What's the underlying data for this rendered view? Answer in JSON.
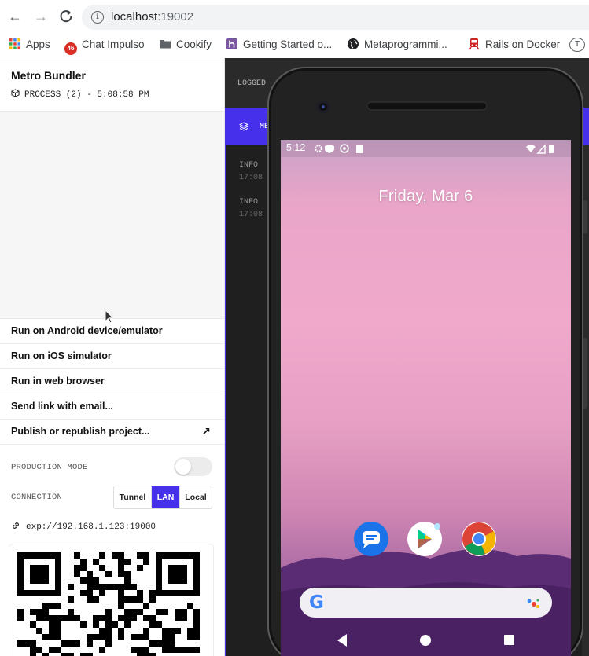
{
  "browser": {
    "url_host": "localhost",
    "url_port": ":19002",
    "bookmarks": [
      {
        "label": "Apps",
        "icon": "apps-grid-icon"
      },
      {
        "label": "Chat Impulso",
        "icon": "chat-badge-icon",
        "badge": "46"
      },
      {
        "label": "Cookify",
        "icon": "folder-icon"
      },
      {
        "label": "Getting Started o...",
        "icon": "heroku-icon"
      },
      {
        "label": "Metaprogrammi...",
        "icon": "globe-icon"
      },
      {
        "label": "Rails on Docker",
        "icon": "train-icon"
      }
    ],
    "profile_initial": "T"
  },
  "sidebar": {
    "title": "Metro Bundler",
    "process": "PROCESS (2) - 5:08:58 PM",
    "actions": [
      {
        "label": "Run on Android device/emulator"
      },
      {
        "label": "Run on iOS simulator"
      },
      {
        "label": "Run in web browser"
      },
      {
        "label": "Send link with email..."
      },
      {
        "label": "Publish or republish project...",
        "icon": "external-arrow-icon"
      }
    ],
    "production_mode_label": "PRODUCTION MODE",
    "production_mode_on": false,
    "connection_label": "CONNECTION",
    "connection_options": [
      "Tunnel",
      "LAN",
      "Local"
    ],
    "connection_selected": "LAN",
    "exp_url": "exp://192.168.1.123:19000"
  },
  "logs": {
    "header": "LOGGED",
    "tab_label": "ME",
    "lines": [
      {
        "level": "INFO",
        "time": "17:08"
      },
      {
        "level": "INFO",
        "time": "17:08"
      }
    ]
  },
  "phone": {
    "time": "5:12",
    "date": "Friday, Mar 6",
    "apps": [
      "messages-icon",
      "play-store-icon",
      "chrome-icon"
    ],
    "search_logo": "G"
  },
  "colors": {
    "accent": "#4630eb"
  }
}
